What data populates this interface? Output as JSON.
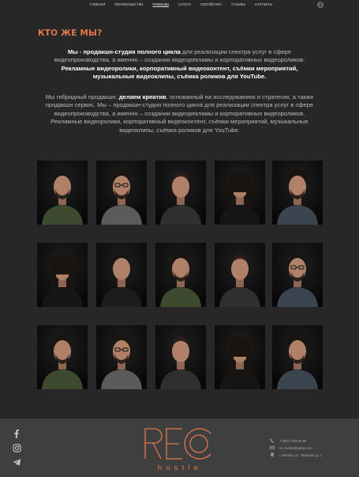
{
  "nav": {
    "items": [
      "главная",
      "преимущества",
      "команда",
      "услуги",
      "портфолио",
      "отзывы",
      "контакты"
    ],
    "active_index": 2
  },
  "section": {
    "title": "КТО ЖЕ МЫ?"
  },
  "intro": {
    "bold_lead": "Мы - продакшн-студия полного цикла",
    "text_after_lead": " для реализации спектра услуг в сфере видеопроизводства, а именно – создании видеорекламы и корпоративных видеороликов. ",
    "bold_tail": "Рекламные видеоролики, корпоративный видеоконтент, съёмки мероприятий, музыкальные видеоклипы, съёмка роликов для YouTube."
  },
  "about": {
    "text_before": "Мы гибридный продакшн: ",
    "bold": "делаем креатив",
    "text_after": ", основанный на исследованиях и стратегии, а также продакшн сервис. Мы – продакшн-студия полного цикла для реализации спектра услуг в сфере видеопроизводства, а именно – создании видеорекламы и корпоративных видеороликов. Рекламные видеоролики, корпоративный видеоконтент, съёмки мероприятий, музыкальные видеоклипы, съёмка роликов для YouTube."
  },
  "team": {
    "photos": [
      {
        "kind": "man-beard",
        "shirt": "#3d4a30"
      },
      {
        "kind": "man-glasses",
        "shirt": "#5b5b5b"
      },
      {
        "kind": "man-bald",
        "shirt": "#2f2f2f"
      },
      {
        "kind": "woman",
        "shirt": "#151515"
      },
      {
        "kind": "man-curly",
        "shirt": "#3a4550"
      },
      {
        "kind": "woman",
        "shirt": "#151515"
      },
      {
        "kind": "man-short",
        "shirt": "#1c1c1c"
      },
      {
        "kind": "man-beard",
        "shirt": "#3d4a30"
      },
      {
        "kind": "man-bald",
        "shirt": "#2f2f2f"
      },
      {
        "kind": "man-glasses",
        "shirt": "#3a4550"
      },
      {
        "kind": "man-beard",
        "shirt": "#3d4a30"
      },
      {
        "kind": "man-glasses",
        "shirt": "#5b5b5b"
      },
      {
        "kind": "man-bald",
        "shirt": "#2f2f2f"
      },
      {
        "kind": "woman",
        "shirt": "#151515"
      },
      {
        "kind": "man-curly",
        "shirt": "#3a4550"
      }
    ]
  },
  "footer": {
    "social_icons": [
      "facebook-icon",
      "instagram-icon",
      "telegram-icon"
    ],
    "logo_letters": "REC",
    "logo_word": "hustle",
    "contacts": [
      {
        "icon": "phone-icon",
        "text": "+7(907) 555 55 55"
      },
      {
        "icon": "mail-icon",
        "text": "rec.hustle@gmail.com"
      },
      {
        "icon": "location-icon",
        "text": "г. Москва, ул. Тверская, д. 1"
      }
    ]
  },
  "colors": {
    "background": "#272727",
    "footer": "#3f3f3f",
    "accent": "#e0774a",
    "text": "#b9b9b9"
  }
}
